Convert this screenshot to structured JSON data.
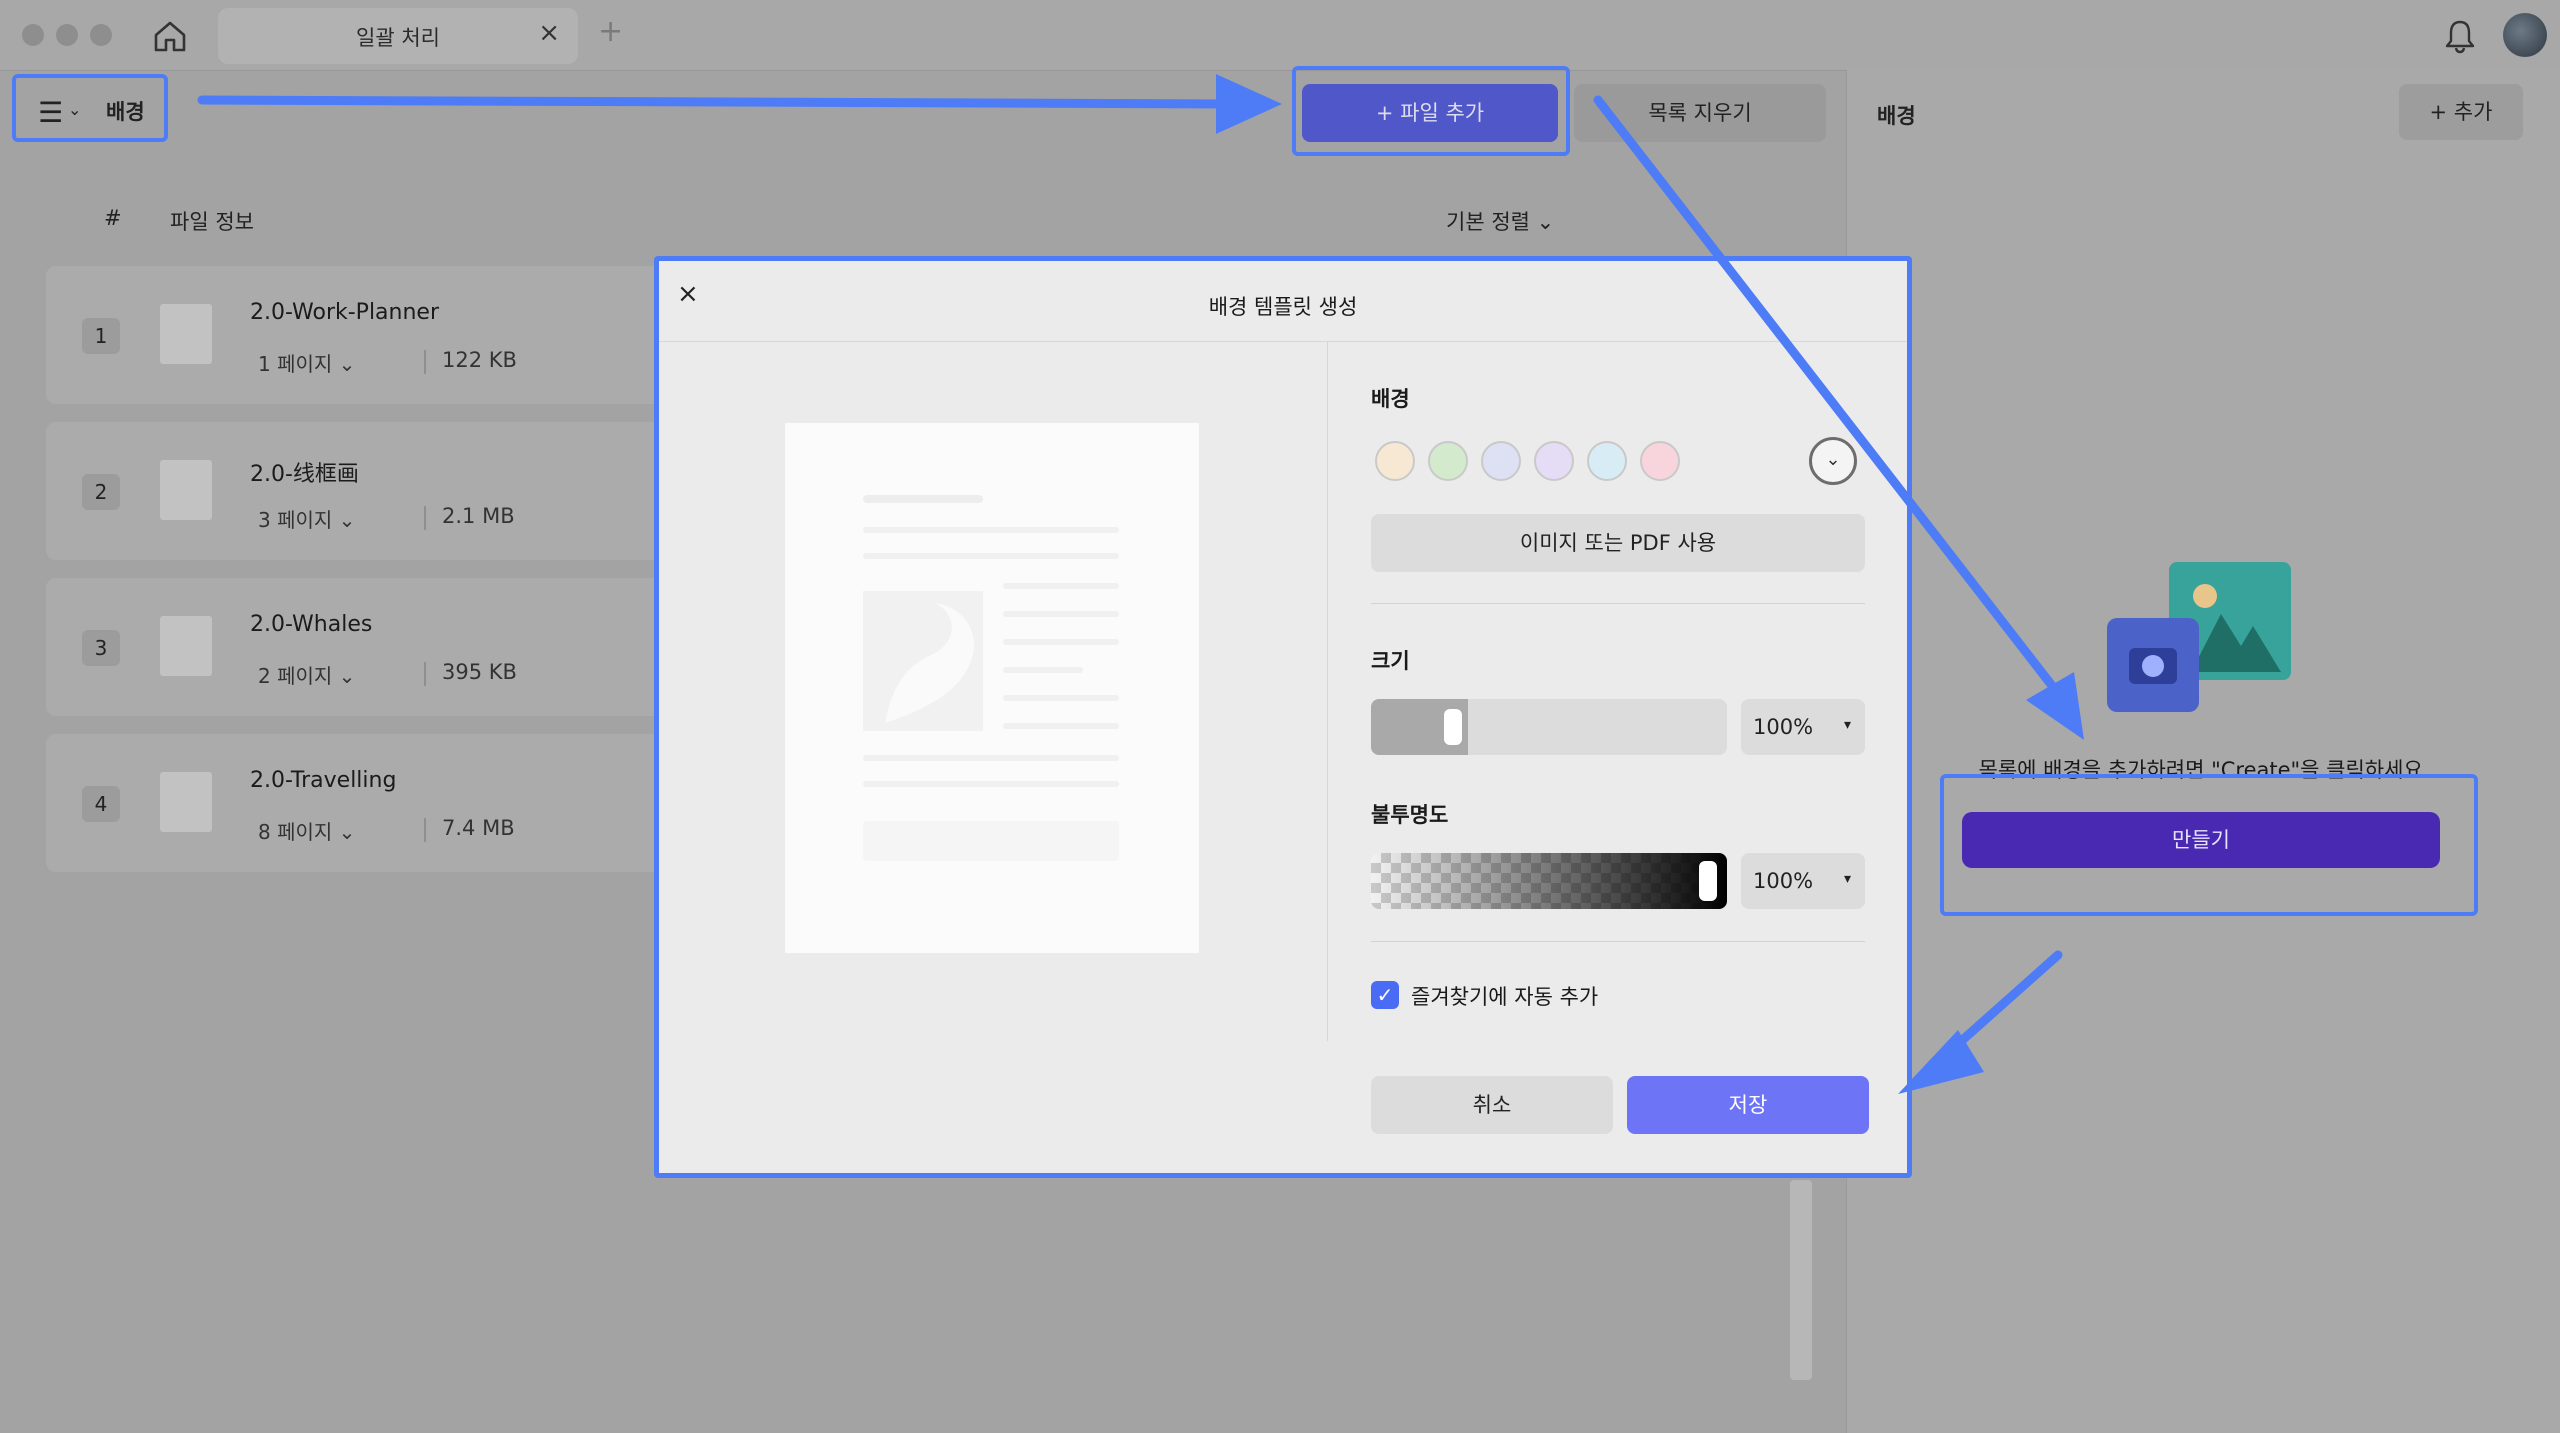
{
  "window": {
    "tab_title": "일괄 처리",
    "tab_close": "×",
    "tab_add": "+"
  },
  "toolbar": {
    "menu_icon": "☰",
    "menu_chevron": "⌄",
    "menu_label": "배경",
    "add_file_label": "+ 파일 추가",
    "clear_list_label": "목록 지우기"
  },
  "file_list": {
    "header_number": "#",
    "header_info": "파일 정보",
    "sort_label": "기본 정렬 ⌄",
    "files": [
      {
        "index": "1",
        "name": "2.0-Work-Planner",
        "pages": "1 페이지 ⌄",
        "size": "122 KB"
      },
      {
        "index": "2",
        "name": "2.0-线框画",
        "pages": "3 페이지 ⌄",
        "size": "2.1 MB"
      },
      {
        "index": "3",
        "name": "2.0-Whales",
        "pages": "2 페이지 ⌄",
        "size": "395 KB"
      },
      {
        "index": "4",
        "name": "2.0-Travelling",
        "pages": "8 페이지 ⌄",
        "size": "7.4 MB"
      }
    ]
  },
  "right_panel": {
    "title": "배경",
    "add_label": "+ 추가",
    "hint": "목록에 배경을 추가하려면 \"Create\"을 클릭하세요.",
    "create_label": "만들기"
  },
  "dialog": {
    "close": "×",
    "title": "배경 템플릿 생성",
    "background_label": "배경",
    "swatch_colors": [
      "#f7e8d3",
      "#d3ebcc",
      "#dde1f3",
      "#e5dcf6",
      "#d7ecf5",
      "#f8d5dd"
    ],
    "more_colors": "⌄",
    "use_image_label": "이미지 또는 PDF 사용",
    "size_label": "크기",
    "size_value": "100%",
    "size_level": 0.14,
    "opacity_label": "불투명도",
    "opacity_value": "100%",
    "opacity_level": 1.0,
    "caret": "▾",
    "favorite_checked": true,
    "favorite_check": "✓",
    "favorite_label": "즐겨찾기에 자동 추가",
    "cancel_label": "취소",
    "save_label": "저장"
  },
  "colors": {
    "annotation_blue": "#4d7cf6",
    "primary_button": "#6d74f6",
    "create_button": "#4a29b2"
  }
}
